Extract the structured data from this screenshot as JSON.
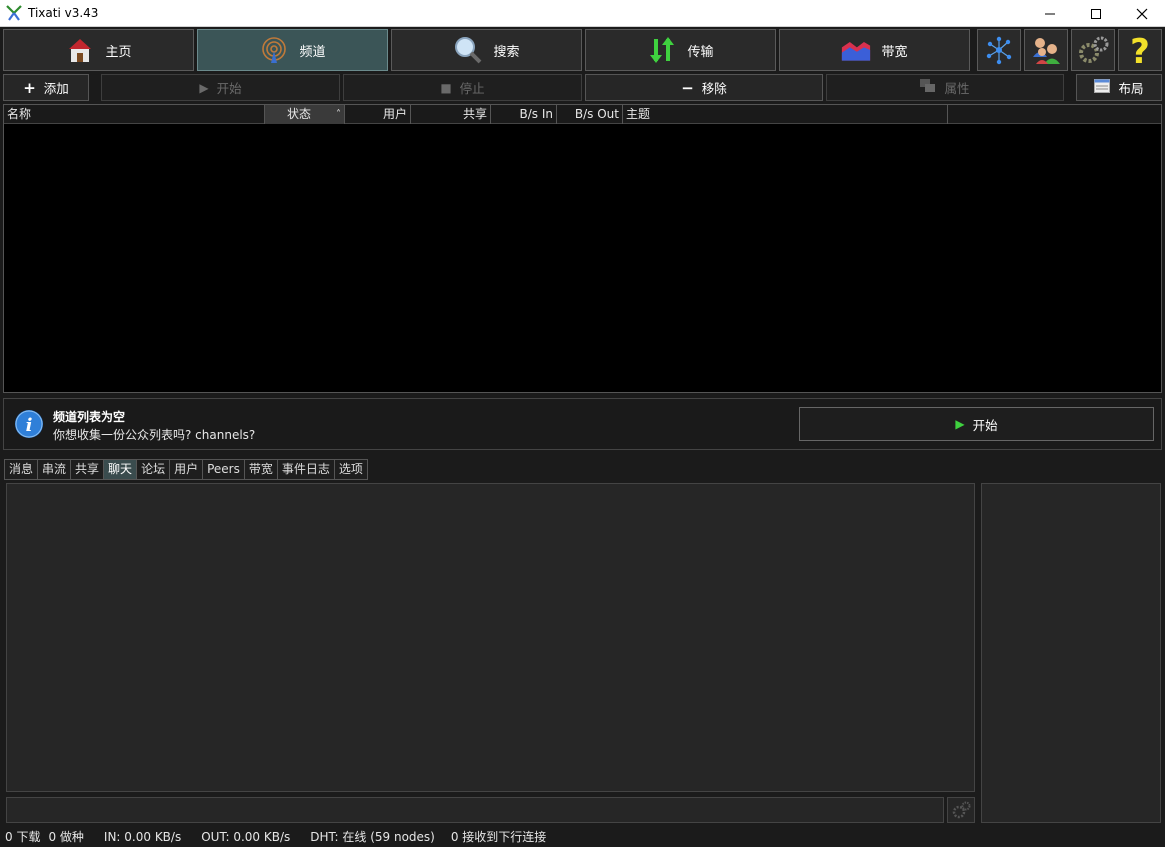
{
  "window": {
    "title": "Tixati v3.43",
    "minimize": "—",
    "maximize": "☐",
    "close": "✕"
  },
  "nav": {
    "home": "主页",
    "channels": "频道",
    "search": "搜索",
    "transfers": "传输",
    "bandwidth": "带宽",
    "icons": [
      "network-icon",
      "users-icon",
      "settings-icon",
      "help-icon"
    ]
  },
  "actions": {
    "add": "添加",
    "start": "开始",
    "stop": "停止",
    "remove": "移除",
    "properties": "属性",
    "layout": "布局"
  },
  "table": {
    "columns": [
      "名称",
      "状态",
      "用户",
      "共享",
      "B/s In",
      "B/s Out",
      "主题"
    ],
    "sort_indicator": "˄",
    "rows": []
  },
  "info": {
    "title": "频道列表为空",
    "text": "你想收集一份公众列表吗? channels?",
    "start_button": "开始"
  },
  "tabs": [
    "消息",
    "串流",
    "共享",
    "聊天",
    "论坛",
    "用户",
    "Peers",
    "带宽",
    "事件日志",
    "选项"
  ],
  "active_tab": "聊天",
  "status": {
    "downloads": "0 下载",
    "seeds": "0 做种",
    "in": "IN: 0.00 KB/s",
    "out": "OUT: 0.00 KB/s",
    "dht": "DHT: 在线 (59 nodes)",
    "incoming": "0 接收到下行连接"
  },
  "colors": {
    "active_nav": "#3b5557",
    "active_tab": "#3a4c4e",
    "table_bg": "#000000",
    "panel_bg": "#262626",
    "accent_green": "#3fd13f"
  }
}
